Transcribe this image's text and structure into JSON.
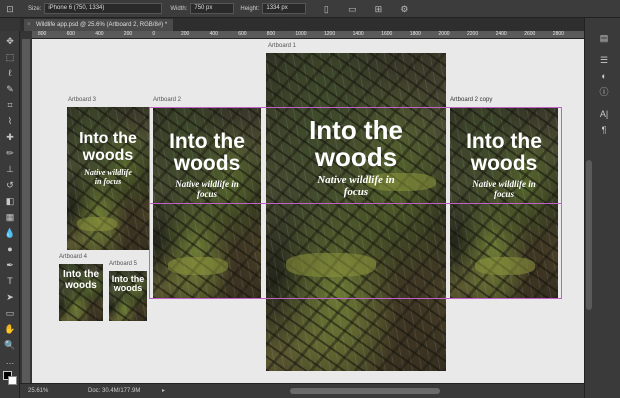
{
  "options_bar": {
    "size_label": "Size:",
    "size_value": "iPhone 6 (750, 1334)",
    "width_label": "Width:",
    "width_value": "750 px",
    "height_label": "Height:",
    "height_value": "1334 px"
  },
  "document_tab": {
    "title": "Wildlife app.psd @ 25.6% (Artboard 2, RGB/8#) *",
    "close_glyph": "×"
  },
  "ruler_ticks": [
    "800",
    "600",
    "400",
    "200",
    "0",
    "200",
    "400",
    "600",
    "800",
    "1000",
    "1200",
    "1400",
    "1600",
    "1800",
    "2000",
    "2200",
    "2400",
    "2600",
    "2800"
  ],
  "artboards": {
    "ab1": {
      "label": "Artboard 1",
      "title": "Into the woods",
      "subtitle": "Native wildlife in focus"
    },
    "ab2": {
      "label": "Artboard 2",
      "title": "Into the woods",
      "subtitle": "Native wildlife in focus"
    },
    "ab3": {
      "label": "Artboard 3",
      "title": "Into the woods",
      "subtitle": "Native wildlife in focus"
    },
    "ab4": {
      "label": "Artboard 4",
      "title": "Into the woods"
    },
    "ab5": {
      "label": "Artboard 5",
      "title": "Into the woods"
    },
    "ab2copy": {
      "label": "Artboard 2 copy",
      "title": "Into the woods",
      "subtitle": "Native wildlife in focus"
    }
  },
  "status": {
    "zoom": "25.61%",
    "doc_info": "Doc: 30.4M/177.9M"
  },
  "colors": {
    "guide": "#c060c8",
    "canvas_bg": "#e9e9e9"
  }
}
